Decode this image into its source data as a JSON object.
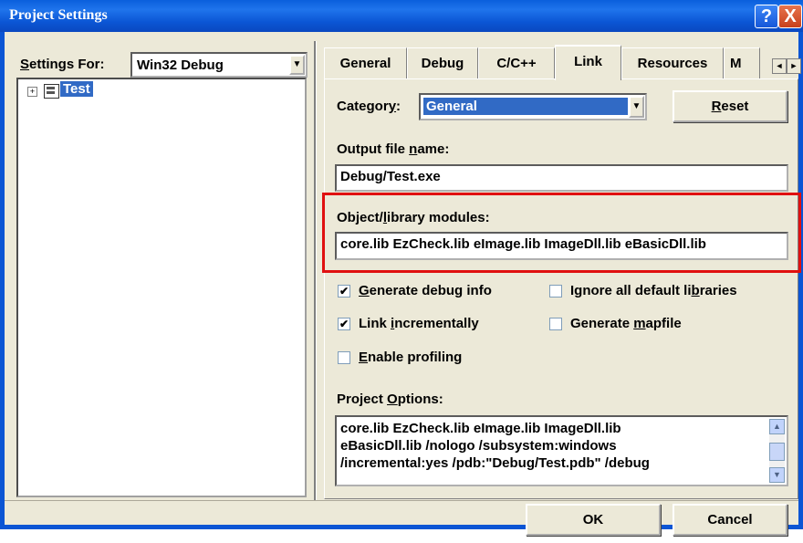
{
  "window": {
    "title": "Project Settings",
    "help_glyph": "?",
    "close_glyph": "X"
  },
  "settings_for": {
    "label_pre": "",
    "label_ul": "S",
    "label_post": "ettings For:",
    "value": "Win32 Debug"
  },
  "tree": {
    "expand_glyph": "+",
    "root_label": "Test"
  },
  "tabs": [
    {
      "label": "General"
    },
    {
      "label": "Debug"
    },
    {
      "label": "C/C++"
    },
    {
      "label": "Link",
      "active": true
    },
    {
      "label": "Resources"
    },
    {
      "label": "M"
    }
  ],
  "tab_scroll": {
    "left": "◄",
    "right": "►"
  },
  "category": {
    "label_pre": "Categor",
    "label_ul": "y",
    "label_post": ":",
    "value": "General",
    "reset_pre": "",
    "reset_ul": "R",
    "reset_post": "eset"
  },
  "output_file": {
    "label_pre": "Output file ",
    "label_ul": "n",
    "label_post": "ame:",
    "value": "Debug/Test.exe"
  },
  "object_modules": {
    "label_pre": "Object/",
    "label_ul": "l",
    "label_post": "ibrary modules:",
    "value": "core.lib EzCheck.lib eImage.lib ImageDll.lib eBasicDll.lib"
  },
  "options": {
    "generate_debug": {
      "checked": true,
      "pre": "",
      "ul": "G",
      "post": "enerate debug info"
    },
    "ignore_defaults": {
      "checked": false,
      "pre": "Ignore all default li",
      "ul": "b",
      "post": "raries"
    },
    "link_incrementally": {
      "checked": true,
      "pre": "Link ",
      "ul": "i",
      "post": "ncrementally"
    },
    "generate_mapfile": {
      "checked": false,
      "pre": "Generate ",
      "ul": "m",
      "post": "apfile"
    },
    "enable_profiling": {
      "checked": false,
      "pre": "",
      "ul": "E",
      "post": "nable profiling"
    }
  },
  "check_glyph": "✔",
  "project_options": {
    "label_pre": "Project ",
    "label_ul": "O",
    "label_post": "ptions:",
    "lines": [
      "core.lib EzCheck.lib eImage.lib ImageDll.lib",
      "eBasicDll.lib /nologo /subsystem:windows",
      "/incremental:yes /pdb:\"Debug/Test.pdb\" /debug"
    ],
    "scroll_up": "▲",
    "scroll_down": "▼"
  },
  "buttons": {
    "ok": "OK",
    "cancel": "Cancel"
  }
}
